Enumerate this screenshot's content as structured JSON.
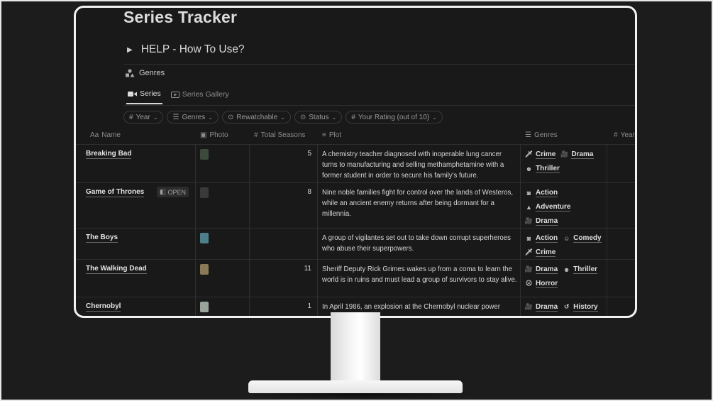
{
  "page": {
    "title": "Series Tracker",
    "help_label": "HELP - How To Use?",
    "genres_link": "Genres"
  },
  "tabs": [
    {
      "label": "Series",
      "active": true,
      "icon": "video-camera-icon"
    },
    {
      "label": "Series Gallery",
      "active": false,
      "icon": "gallery-icon"
    }
  ],
  "filters": [
    {
      "label": "Year",
      "icon": "hash-icon"
    },
    {
      "label": "Genres",
      "icon": "list-icon"
    },
    {
      "label": "Rewatchable",
      "icon": "circle-chevron-icon"
    },
    {
      "label": "Status",
      "icon": "circle-chevron-icon"
    },
    {
      "label": "Your Rating (out of 10)",
      "icon": "hash-icon"
    }
  ],
  "columns": {
    "name": "Name",
    "name_icon": "Aa",
    "photo": "Photo",
    "seasons": "Total Seasons",
    "plot": "Plot",
    "genres": "Genres",
    "year": "Year"
  },
  "open_label": "OPEN",
  "rows": [
    {
      "name": "Breaking Bad",
      "seasons": "5",
      "plot": "A chemistry teacher diagnosed with inoperable lung cancer turns to manufacturing and selling methamphetamine with a former student in order to secure his family's future.",
      "genres": [
        {
          "label": "Crime",
          "icon": "dagger-icon"
        },
        {
          "label": "Drama",
          "icon": "film-camera-icon"
        },
        {
          "label": "Thriller",
          "icon": "mask-icon"
        }
      ],
      "thumb_color": "#3c4a3c"
    },
    {
      "name": "Game of Thrones",
      "seasons": "8",
      "plot": "Nine noble families fight for control over the lands of Westeros, while an ancient enemy returns after being dormant for a millennia.",
      "genres": [
        {
          "label": "Action",
          "icon": "camera-icon"
        },
        {
          "label": "Adventure",
          "icon": "mountain-icon"
        },
        {
          "label": "Drama",
          "icon": "film-camera-icon"
        }
      ],
      "thumb_color": "#3a3a3a"
    },
    {
      "name": "The Boys",
      "seasons": "",
      "plot": "A group of vigilantes set out to take down corrupt superheroes who abuse their superpowers.",
      "genres": [
        {
          "label": "Action",
          "icon": "camera-icon"
        },
        {
          "label": "Comedy",
          "icon": "smiley-icon"
        },
        {
          "label": "Crime",
          "icon": "dagger-icon"
        }
      ],
      "thumb_color": "#4d7f8a"
    },
    {
      "name": "The Walking Dead",
      "seasons": "11",
      "plot": "Sheriff Deputy Rick Grimes wakes up from a coma to learn the world is in ruins and must lead a group of survivors to stay alive.",
      "genres": [
        {
          "label": "Drama",
          "icon": "film-camera-icon"
        },
        {
          "label": "Thriller",
          "icon": "mask-icon"
        },
        {
          "label": "Horror",
          "icon": "skull-icon"
        }
      ],
      "thumb_color": "#8a7a55"
    },
    {
      "name": "Chernobyl",
      "seasons": "1",
      "plot": "In April 1986, an explosion at the Chernobyl nuclear power",
      "genres": [
        {
          "label": "Drama",
          "icon": "film-camera-icon"
        },
        {
          "label": "History",
          "icon": "history-icon"
        }
      ],
      "thumb_color": "#9aa39a"
    }
  ]
}
